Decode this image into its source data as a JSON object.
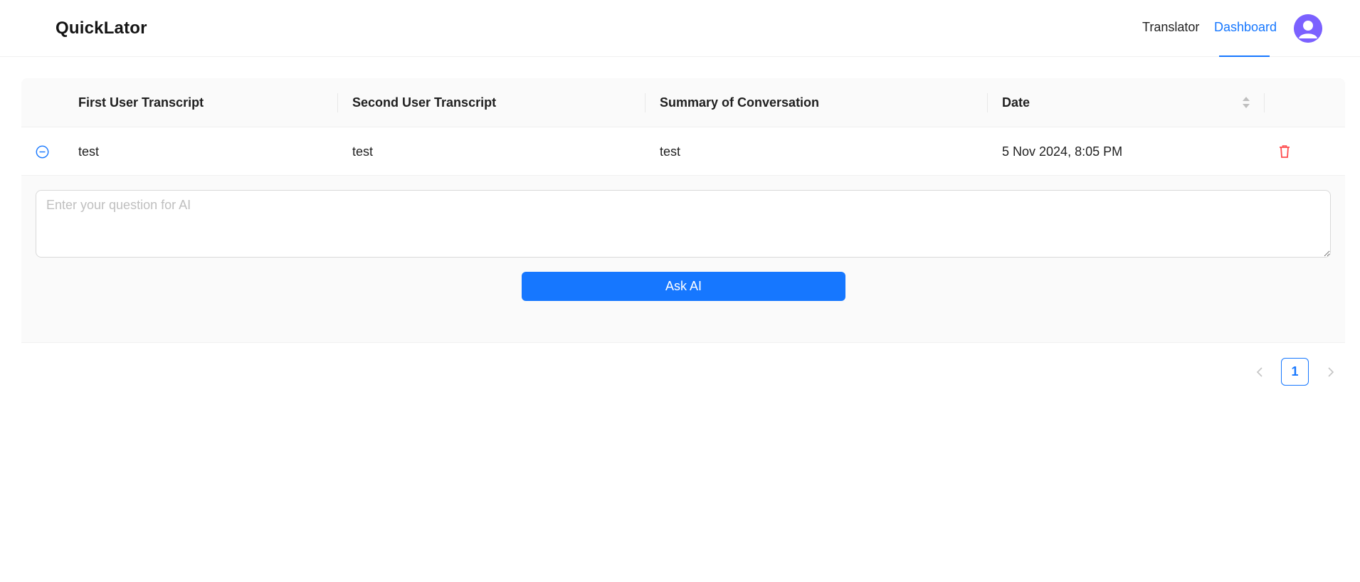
{
  "app": {
    "title": "QuickLator"
  },
  "nav": {
    "items": [
      {
        "label": "Translator",
        "active": false
      },
      {
        "label": "Dashboard",
        "active": true
      }
    ],
    "avatar_icon": "user-avatar-icon"
  },
  "table": {
    "columns": [
      "First User Transcript",
      "Second User Transcript",
      "Summary of Conversation",
      "Date"
    ],
    "rows": [
      {
        "first": "test",
        "second": "test",
        "summary": "test",
        "date": "5 Nov 2024, 8:05 PM",
        "expanded": true
      }
    ],
    "expanded": {
      "question_placeholder": "Enter your question for AI",
      "question_value": "",
      "ask_label": "Ask AI"
    }
  },
  "pagination": {
    "current": "1"
  },
  "colors": {
    "accent": "#1677ff",
    "danger": "#ff4d4f",
    "avatar": "#7b61ff"
  }
}
